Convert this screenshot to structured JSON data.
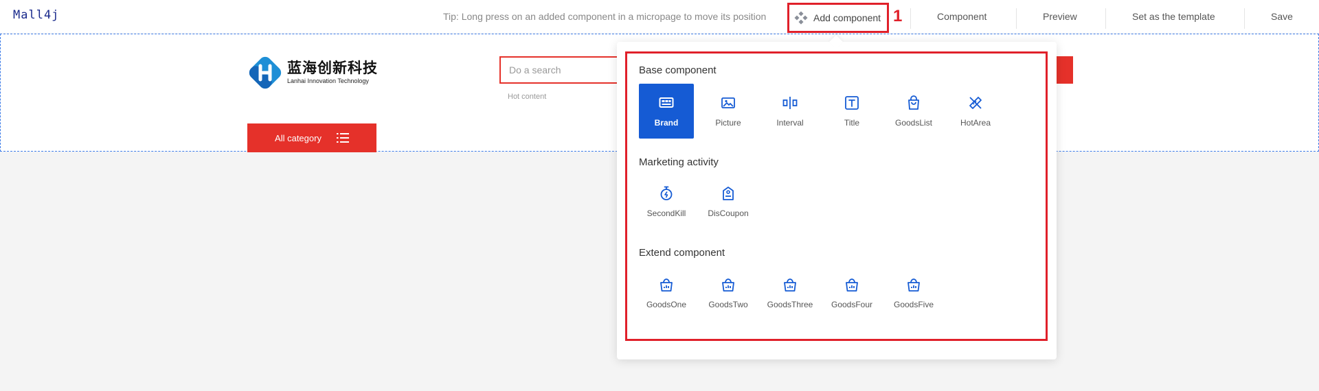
{
  "app": {
    "logo": "Mall4j"
  },
  "toolbar": {
    "tip": "Tip: Long press on an added component in a micropage to move its position",
    "add_component": "Add component",
    "callout_number": "1",
    "component": "Component",
    "preview": "Preview",
    "set_template": "Set as the template",
    "save": "Save"
  },
  "header": {
    "brand_cn": "蓝海创新科技",
    "brand_en": "Lanhai Innovation Technology",
    "search_placeholder": "Do a search",
    "hot_content": "Hot content",
    "all_category": "All category"
  },
  "popup": {
    "sections": [
      {
        "title": "Base component",
        "items": [
          "Brand",
          "Picture",
          "Interval",
          "Title",
          "GoodsList",
          "HotArea"
        ]
      },
      {
        "title": "Marketing activity",
        "items": [
          "SecondKill",
          "DisCoupon"
        ]
      },
      {
        "title": "Extend component",
        "items": [
          "GoodsOne",
          "GoodsTwo",
          "GoodsThree",
          "GoodsFour",
          "GoodsFive"
        ]
      }
    ],
    "active_item": "Brand"
  },
  "colors": {
    "accent": "#155bd4",
    "brand_red": "#e5312a",
    "annotation_red": "#e0202a"
  }
}
